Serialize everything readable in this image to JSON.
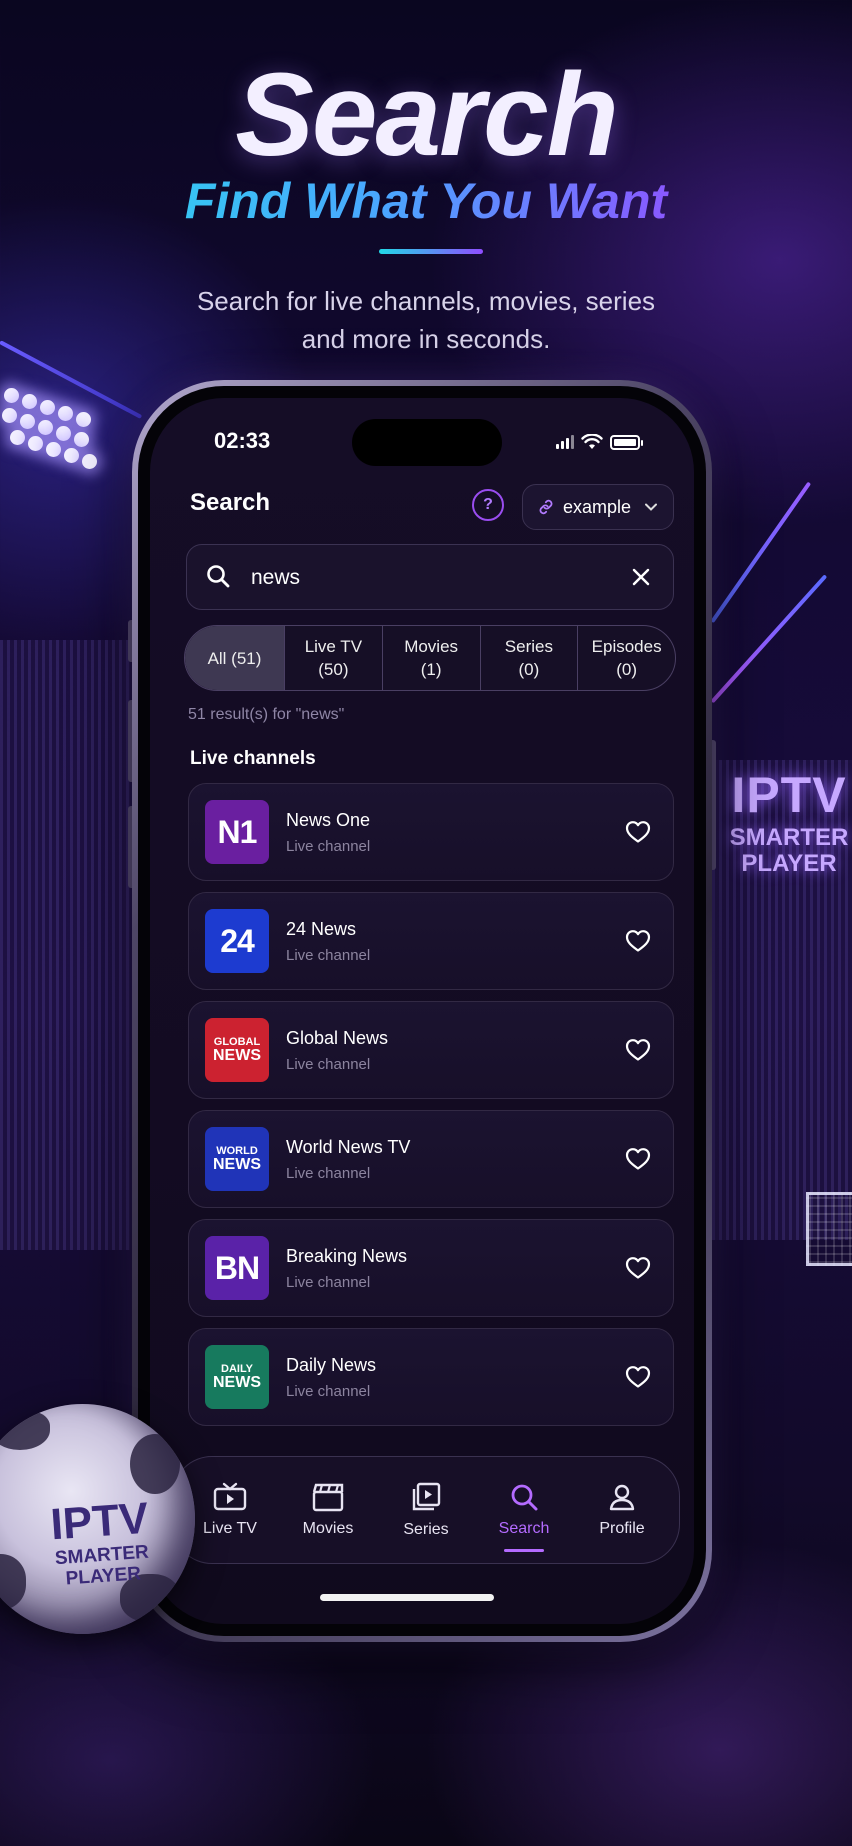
{
  "hero": {
    "title": "Search",
    "subtitle": "Find What You Want",
    "description": "Search for live channels, movies, series and more in seconds."
  },
  "brand": {
    "line1": "IPTV",
    "line2": "SMARTER",
    "line3": "PLAYER"
  },
  "status_bar": {
    "time": "02:33"
  },
  "header": {
    "title": "Search",
    "help_label": "?",
    "playlist_label": "example"
  },
  "search": {
    "value": "news",
    "placeholder": ""
  },
  "filters": [
    {
      "label": "All (51)",
      "active": true
    },
    {
      "label": "Live TV\n(50)",
      "active": false
    },
    {
      "label": "Movies\n(1)",
      "active": false
    },
    {
      "label": "Series\n(0)",
      "active": false
    },
    {
      "label": "Episodes\n(0)",
      "active": false
    }
  ],
  "results_text": "51 result(s) for \"news\"",
  "section_label": "Live channels",
  "channels": [
    {
      "name": "News One",
      "type": "Live channel",
      "logo_lines": [
        "N1"
      ],
      "logo_color": "#6a1fa0"
    },
    {
      "name": "24 News",
      "type": "Live channel",
      "logo_lines": [
        "24"
      ],
      "logo_color": "#1d3bd0"
    },
    {
      "name": "Global News",
      "type": "Live channel",
      "logo_lines": [
        "GLOBAL",
        "NEWS"
      ],
      "logo_color": "#cc2230"
    },
    {
      "name": "World News TV",
      "type": "Live channel",
      "logo_lines": [
        "WORLD",
        "NEWS"
      ],
      "logo_color": "#2034b8"
    },
    {
      "name": "Breaking News",
      "type": "Live channel",
      "logo_lines": [
        "BN"
      ],
      "logo_color": "#5a22a8"
    },
    {
      "name": "Daily News",
      "type": "Live channel",
      "logo_lines": [
        "DAILY",
        "NEWS"
      ],
      "logo_color": "#177a5e"
    }
  ],
  "nav": [
    {
      "label": "Live TV",
      "icon": "tv-icon",
      "active": false
    },
    {
      "label": "Movies",
      "icon": "clapperboard-icon",
      "active": false
    },
    {
      "label": "Series",
      "icon": "series-icon",
      "active": false
    },
    {
      "label": "Search",
      "icon": "search-icon",
      "active": true
    },
    {
      "label": "Profile",
      "icon": "profile-icon",
      "active": false
    }
  ],
  "colors": {
    "accent": "#b46bff",
    "background": "#130b22"
  }
}
